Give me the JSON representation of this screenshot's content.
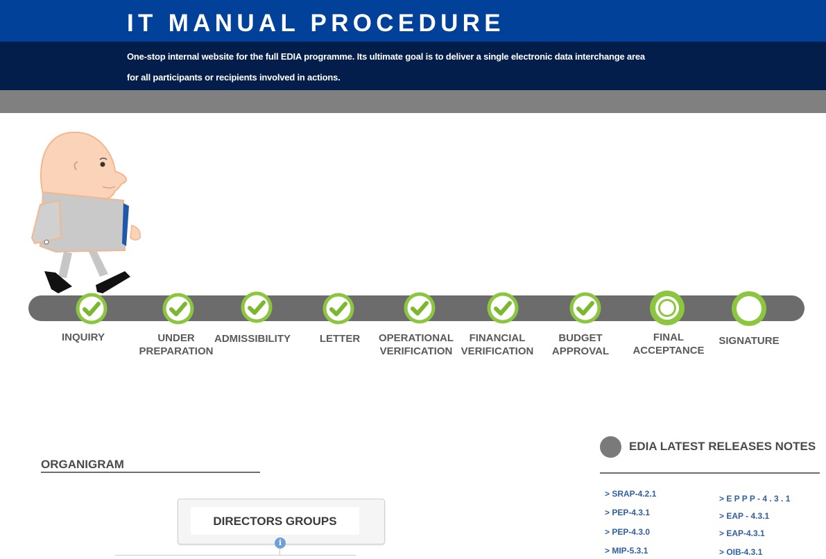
{
  "header": {
    "title": "IT MANUAL PROCEDURE",
    "line1": "One-stop internal website for the full EDIA programme. Its ultimate goal is to deliver a single electronic data interchange area",
    "line2": "for all participants or recipients involved in  actions."
  },
  "colors": {
    "header_top": "#02419a",
    "header_bottom": "#031e4b",
    "band": "#808080",
    "track": "#6c6c6c",
    "step_green": "#8cc63f",
    "link_blue": "#2f5fa0"
  },
  "steps": [
    {
      "line1": "INQUIRY",
      "line2": "",
      "state": "done"
    },
    {
      "line1": "UNDER",
      "line2": "PREPARATION",
      "state": "done"
    },
    {
      "line1": "ADMISSIBILITY",
      "line2": "",
      "state": "done"
    },
    {
      "line1": "LETTER",
      "line2": "",
      "state": "done"
    },
    {
      "line1": "OPERATIONAL",
      "line2": "VERIFICATION",
      "state": "done"
    },
    {
      "line1": "FINANCIAL",
      "line2": "VERIFICATION",
      "state": "done"
    },
    {
      "line1": "BUDGET",
      "line2": "APPROVAL",
      "state": "done"
    },
    {
      "line1": "FINAL",
      "line2": "ACCEPTANCE",
      "state": "current"
    },
    {
      "line1": "SIGNATURE",
      "line2": "",
      "state": "pending"
    }
  ],
  "organigram": {
    "title": "ORGANIGRAM",
    "root": "DIRECTORS GROUPS",
    "info_icon": "i"
  },
  "releases": {
    "title": "EDIA LATEST RELEASES NOTES",
    "left": [
      "> SRAP-4.2.1",
      "> PEP-4.3.1",
      "> PEP-4.3.0",
      "> MIP-5.3.1"
    ],
    "right": [
      "> E P P P - 4 . 3 . 1",
      "> EAP - 4.3.1",
      "> EAP-4.3.1",
      "> OIB-4.3.1"
    ]
  },
  "icons": [
    "check-icon",
    "info-icon",
    "bullet-dot-icon",
    "mascot-figure"
  ]
}
